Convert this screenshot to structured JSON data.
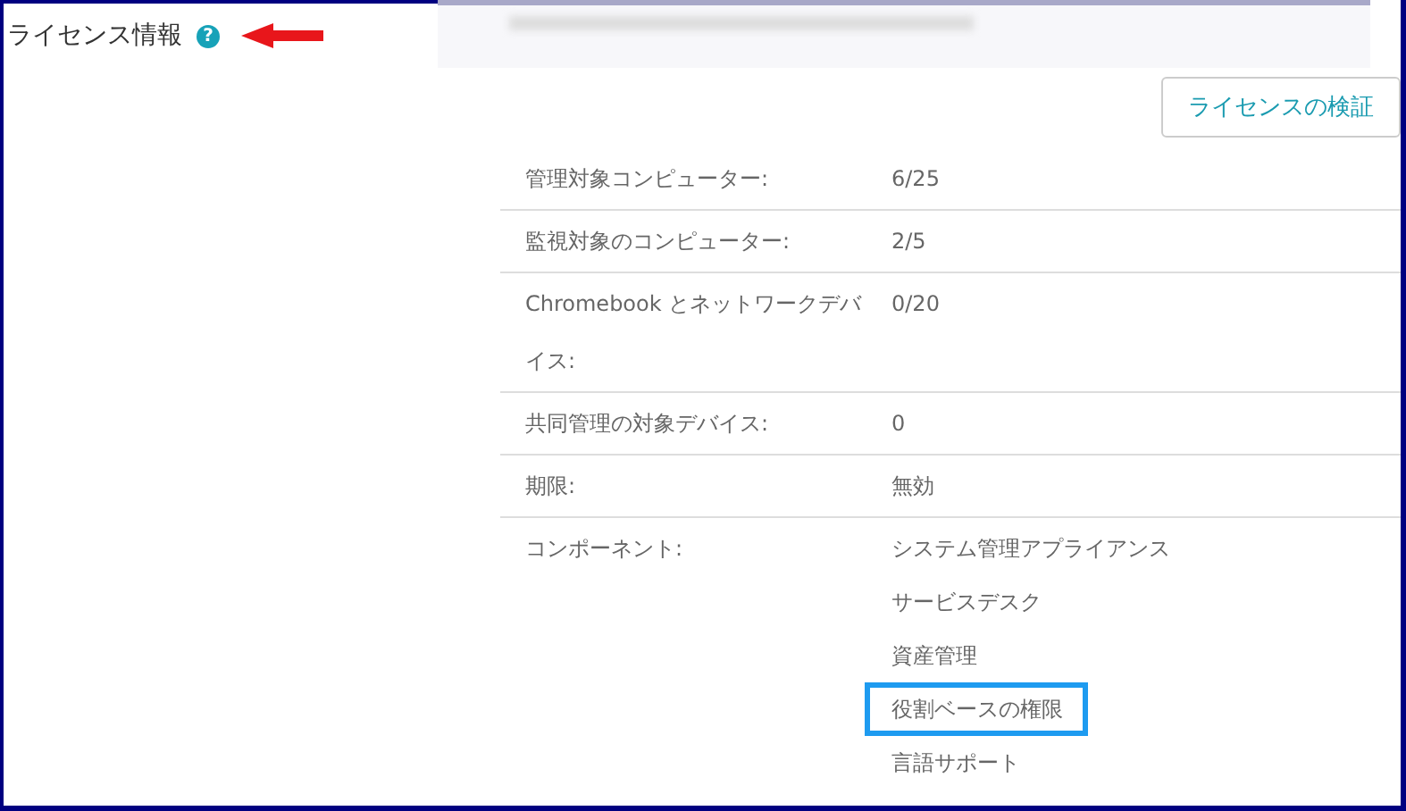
{
  "section": {
    "title": "ライセンス情報",
    "help_icon": "?"
  },
  "verify_button": "ライセンスの検証",
  "details": [
    {
      "label": "管理対象コンピューター:",
      "value": "6/25"
    },
    {
      "label": "監視対象のコンピューター:",
      "value": "2/5"
    },
    {
      "label": "Chromebook とネットワークデバイス:",
      "value": "0/20"
    },
    {
      "label": "共同管理の対象デバイス:",
      "value": "0"
    },
    {
      "label": "期限:",
      "value": "無効"
    }
  ],
  "components": {
    "label": "コンポーネント:",
    "items": [
      {
        "name": "システム管理アプライアンス",
        "highlighted": false
      },
      {
        "name": "サービスデスク",
        "highlighted": false
      },
      {
        "name": "資産管理",
        "highlighted": false
      },
      {
        "name": "役割ベースの権限",
        "highlighted": true
      },
      {
        "name": "言語サポート",
        "highlighted": false
      }
    ]
  }
}
